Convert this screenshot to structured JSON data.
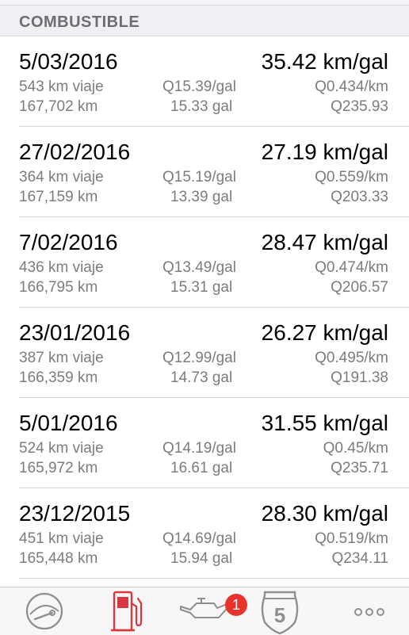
{
  "section": {
    "title": "COMBUSTIBLE"
  },
  "entries": [
    {
      "date": "5/03/2016",
      "efficiency": "35.42 km/gal",
      "trip": "543 km viaje",
      "odometer": "167,702 km",
      "price": "Q15.39/gal",
      "gallons": "15.33 gal",
      "cost_per_km": "Q0.434/km",
      "total": "Q235.93"
    },
    {
      "date": "27/02/2016",
      "efficiency": "27.19 km/gal",
      "trip": "364 km viaje",
      "odometer": "167,159 km",
      "price": "Q15.19/gal",
      "gallons": "13.39 gal",
      "cost_per_km": "Q0.559/km",
      "total": "Q203.33"
    },
    {
      "date": "7/02/2016",
      "efficiency": "28.47 km/gal",
      "trip": "436 km viaje",
      "odometer": "166,795 km",
      "price": "Q13.49/gal",
      "gallons": "15.31 gal",
      "cost_per_km": "Q0.474/km",
      "total": "Q206.57"
    },
    {
      "date": "23/01/2016",
      "efficiency": "26.27 km/gal",
      "trip": "387 km viaje",
      "odometer": "166,359 km",
      "price": "Q12.99/gal",
      "gallons": "14.73 gal",
      "cost_per_km": "Q0.495/km",
      "total": "Q191.38"
    },
    {
      "date": "5/01/2016",
      "efficiency": "31.55 km/gal",
      "trip": "524 km viaje",
      "odometer": "165,972 km",
      "price": "Q14.19/gal",
      "gallons": "16.61 gal",
      "cost_per_km": "Q0.45/km",
      "total": "Q235.71"
    },
    {
      "date": "23/12/2015",
      "efficiency": "28.30 km/gal",
      "trip": "451 km viaje",
      "odometer": "165,448 km",
      "price": "Q14.69/gal",
      "gallons": "15.94 gal",
      "cost_per_km": "Q0.519/km",
      "total": "Q234.11"
    }
  ],
  "tabbar": {
    "tabs": [
      {
        "name": "dashboard",
        "icon": "speedometer-icon",
        "active": false
      },
      {
        "name": "fuel",
        "icon": "fuel-pump-icon",
        "active": true
      },
      {
        "name": "oil",
        "icon": "oil-can-icon",
        "active": false
      },
      {
        "name": "route",
        "icon": "highway-shield-icon",
        "active": false
      },
      {
        "name": "more",
        "icon": "more-dots-icon",
        "active": false
      }
    ],
    "oil_badge": "1",
    "route_number": "5"
  },
  "colors": {
    "accent": "#d9363e",
    "inactive_icon": "#8e8e93",
    "badge": "#e8332d"
  }
}
